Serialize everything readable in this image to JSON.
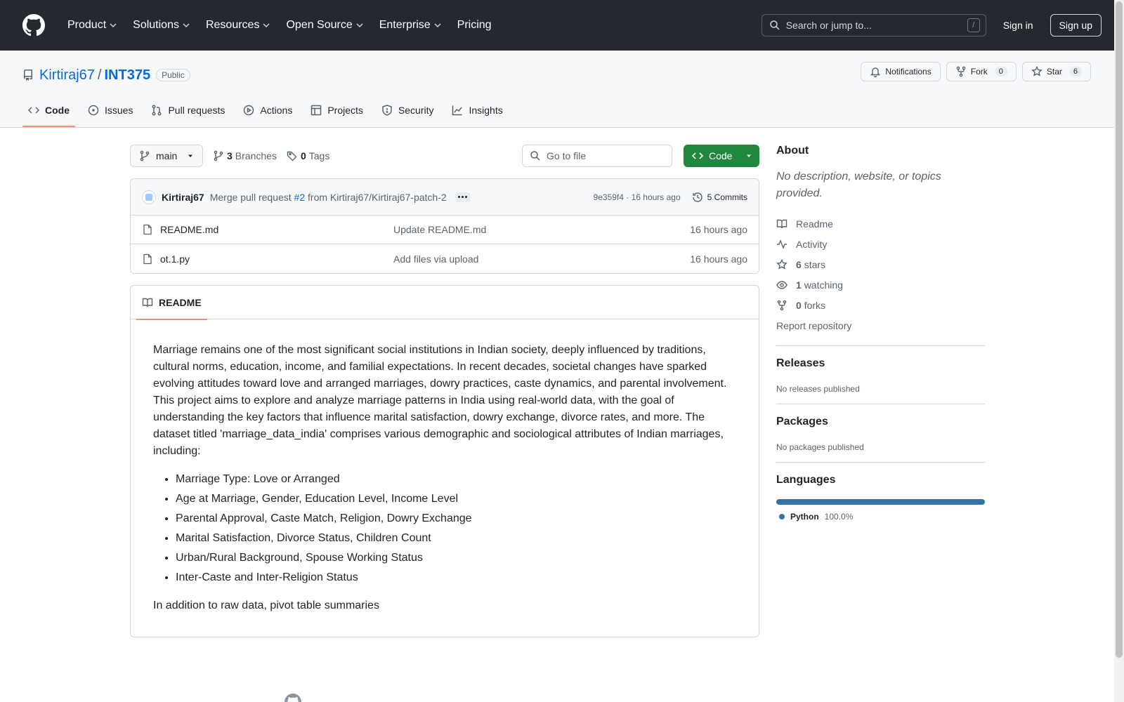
{
  "header": {
    "nav": [
      {
        "label": "Product",
        "dropdown": true
      },
      {
        "label": "Solutions",
        "dropdown": true
      },
      {
        "label": "Resources",
        "dropdown": true
      },
      {
        "label": "Open Source",
        "dropdown": true
      },
      {
        "label": "Enterprise",
        "dropdown": true
      },
      {
        "label": "Pricing",
        "dropdown": false
      }
    ],
    "search_placeholder": "Search or jump to...",
    "search_shortcut": "/",
    "sign_in": "Sign in",
    "sign_up": "Sign up"
  },
  "repo": {
    "owner": "Kirtiraj67",
    "separator": "/",
    "name": "INT375",
    "visibility": "Public",
    "actions": {
      "notifications": "Notifications",
      "fork_label": "Fork",
      "fork_count": "0",
      "star_label": "Star",
      "star_count": "6"
    },
    "tabs": [
      {
        "label": "Code",
        "icon": "code-icon",
        "active": true
      },
      {
        "label": "Issues",
        "icon": "issue-icon",
        "active": false
      },
      {
        "label": "Pull requests",
        "icon": "pull-request-icon",
        "active": false
      },
      {
        "label": "Actions",
        "icon": "play-icon",
        "active": false
      },
      {
        "label": "Projects",
        "icon": "table-icon",
        "active": false
      },
      {
        "label": "Security",
        "icon": "shield-icon",
        "active": false
      },
      {
        "label": "Insights",
        "icon": "graph-icon",
        "active": false
      }
    ]
  },
  "filebar": {
    "branch": "main",
    "branches_count": "3",
    "branches_label": "Branches",
    "tags_count": "0",
    "tags_label": "Tags",
    "goto_placeholder": "Go to file",
    "code_button": "Code"
  },
  "commit": {
    "author": "Kirtiraj67",
    "msg_prefix": "Merge pull request",
    "pr_ref": "#2",
    "msg_suffix": "from Kirtiraj67/Kirtiraj67-patch-2",
    "sha_time": "9e359f4 · 16 hours ago",
    "commits_label": "5 Commits"
  },
  "files": [
    {
      "name": "README.md",
      "commit": "Update README.md",
      "age": "16 hours ago"
    },
    {
      "name": "ot.1.py",
      "commit": "Add files via upload",
      "age": "16 hours ago"
    }
  ],
  "readme": {
    "tab": "README",
    "intro": "Marriage remains one of the most significant social institutions in Indian society, deeply influenced by traditions, cultural norms, education, income, and familial expectations. In recent decades, societal changes have sparked evolving attitudes toward love and arranged marriages, dowry practices, caste dynamics, and parental involvement. This project aims to explore and analyze marriage patterns in India using real-world data, with the goal of understanding the key factors that influence marital satisfaction, dowry exchange, divorce rates, and more. The dataset titled 'marriage_data_india' comprises various demographic and sociological attributes of Indian marriages, including:",
    "bullets": [
      "Marriage Type: Love or Arranged",
      "Age at Marriage, Gender, Education Level, Income Level",
      "Parental Approval, Caste Match, Religion, Dowry Exchange",
      "Marital Satisfaction, Divorce Status, Children Count",
      "Urban/Rural Background, Spouse Working Status",
      "Inter-Caste and Inter-Religion Status"
    ],
    "outro": "In addition to raw data, pivot table summaries"
  },
  "sidebar": {
    "about_title": "About",
    "about_desc": "No description, website, or topics provided.",
    "links": {
      "readme": "Readme",
      "activity": "Activity",
      "stars_count": "6",
      "stars_label": "stars",
      "watching_count": "1",
      "watching_label": "watching",
      "forks_count": "0",
      "forks_label": "forks",
      "report": "Report repository"
    },
    "releases_title": "Releases",
    "releases_text": "No releases published",
    "packages_title": "Packages",
    "packages_text": "No packages published",
    "languages_title": "Languages",
    "languages": [
      {
        "name": "Python",
        "percent": "100.0%",
        "color": "#3572A5"
      }
    ]
  },
  "colors": {
    "header_bg": "#24292f",
    "link": "#0969da",
    "primary_button": "#1f883d",
    "tab_underline": "#fd8c73"
  }
}
